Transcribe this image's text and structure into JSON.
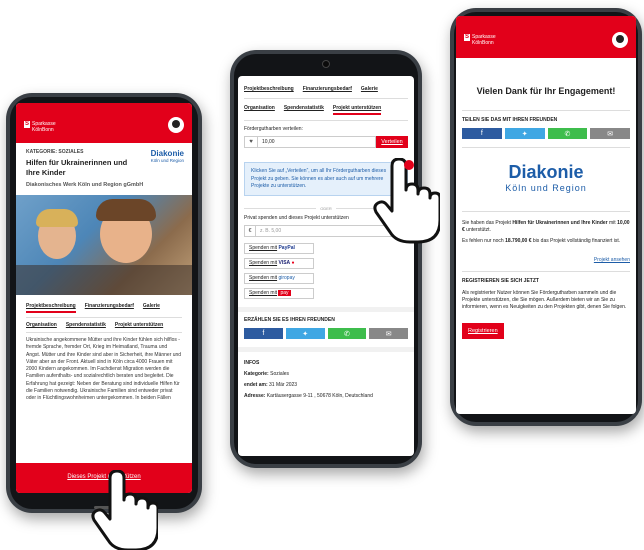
{
  "brand": {
    "logo_line1": "Sparkasse",
    "logo_line2": "KölnBonn",
    "diakonie_name": "Diakonie",
    "diakonie_sub": "Köln und Region"
  },
  "phone1": {
    "category": "KATEGORIE: SOZIALES",
    "title": "Hilfen für Ukrainerinnen und Ihre Kinder",
    "org": "Diakonisches Werk Köln und Region gGmbH",
    "tabs_row1": [
      "Projektbeschreibung",
      "Finanzierungsbedarf",
      "Galerie"
    ],
    "tabs_row2": [
      "Organisation",
      "Spendenstatistik",
      "Projekt unterstützen"
    ],
    "description": "Ukrainische angekommene Mütter und ihre Kinder fühlen sich hilflos - fremde Sprache, fremder Ort, Krieg im Heimatland, Trauma und Angst. Mütter und ihre Kinder sind aber in Sicherheit, ihre Männer und Väter aber an der Front. Aktuell sind in Köln circa 4000 Frauen mit 2000 Kindern angekommen. Im Fachdienst Migration werden die Familien aufenthalts- und sozialrechtlich beraten und begleitet. Die Erfahrung hat gezeigt: Neben der Beratung sind individuelle Hilfen für die Familien notwendig. Ukrainische Familien sind entweder privat oder in Flüchtlingswohnheimen untergekommen. In beiden Fällen",
    "cta": "Dieses Projekt unterstützen"
  },
  "phone2": {
    "tabs_row1": [
      "Projektbeschreibung",
      "Finanzierungsbedarf",
      "Galerie"
    ],
    "tabs_row2": [
      "Organisation",
      "Spendenstatistik",
      "Projekt unterstützen"
    ],
    "distribute_label": "Fördergutharben verteilen:",
    "amount_value": "10,00",
    "distribute_button": "Verteilen",
    "info_text": "Klicken Sie auf „Verteilen“, um all Ihr Fördergutharben dieses Projekt zu geben. Sie können es aber auch auf um mehrere Projekte zu unterstützen.",
    "or": "ODER",
    "private_label": "Privat spenden und dieses Projekt unterstützen",
    "private_currency": "€",
    "private_placeholder": "z. B. 5,00",
    "help": "?",
    "pay_buttons": [
      {
        "label": "Spenden mit",
        "brand": "PayPal"
      },
      {
        "label": "Spenden mit",
        "brand": "VISA"
      },
      {
        "label": "Spenden mit",
        "brand": "giropay"
      },
      {
        "label": "Spenden mit",
        "brand": "pay"
      }
    ],
    "share_title": "ERZÄHLEN SIE ES IHREN FREUNDEN",
    "infos_title": "INFOS",
    "info_lines": [
      {
        "key": "Kategorie:",
        "value": "Soziales"
      },
      {
        "key": "endet am:",
        "value": "31 Mär 2023"
      },
      {
        "key": "Adresse:",
        "value": "Kartäusergasse 9-11 , 50678 Köln, Deutschland"
      }
    ]
  },
  "phone3": {
    "thanks": "Vielen Dank für Ihr Engagement!",
    "share_title": "TEILEN SIE DAS MIT IHREN FREUNDEN",
    "text1_pre": "Sie haben das Projekt ",
    "text1_bold": "Hilfen für Ukrainerinnen und Ihre Kinder",
    "text1_mid": " mit ",
    "text1_amount": "10,00 €",
    "text1_post": " unterstützt.",
    "text2_pre": "Es fehlen nur noch ",
    "text2_amount": "18.790,00 €",
    "text2_post": " bis das Projekt vollständig finanziert ist.",
    "link": "Projekt ansehen",
    "register_title": "REGISTRIEREN SIE SICH JETZT",
    "register_text": "Als registrierter Nutzer können Sie Fördergutharben sammeln und die Projekte unterstützen, die Sie mögen. Außerdem bieten wir an Sie zu informieren, wenn es Neuigkeiten zu den Projekten gibt, denen Sie folgen.",
    "register_button": "Registrieren"
  },
  "icons": [
    "facebook-icon",
    "twitter-icon",
    "whatsapp-icon",
    "mail-icon",
    "heart-icon",
    "hand-pointer-icon"
  ],
  "colors": {
    "accent": "#e2001a",
    "diakonie": "#1d5da8",
    "info_bg": "#e5f0fb"
  }
}
